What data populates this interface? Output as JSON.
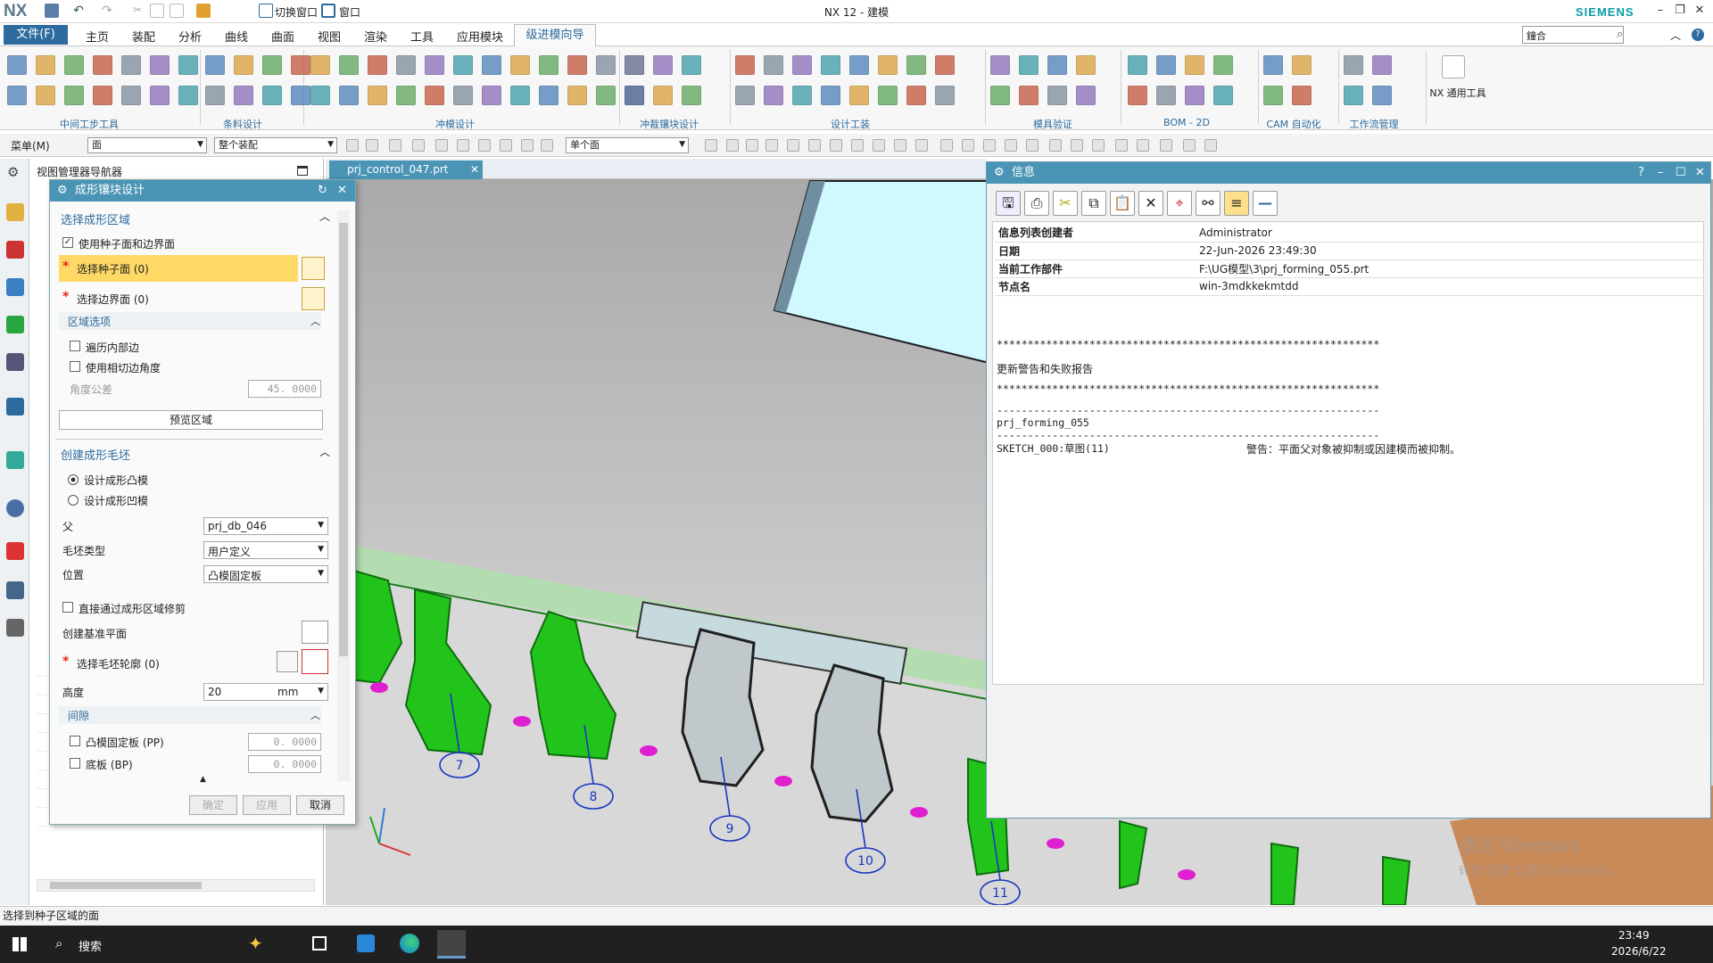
{
  "app": {
    "logo": "NX",
    "window_title": "NX 12 - 建模",
    "brand": "SIEMENS"
  },
  "quickbar": {
    "switch_window": "切换窗口",
    "window": "窗口"
  },
  "menubar": {
    "file": "文件(F)",
    "items": [
      "主页",
      "装配",
      "分析",
      "曲线",
      "曲面",
      "视图",
      "渲染",
      "工具",
      "应用模块"
    ],
    "active": "级进模向导",
    "search_value": "鐘合"
  },
  "ribbon": {
    "groups": [
      "中间工步工具",
      "条料设计",
      "冲模设计",
      "冲裁镶块设计",
      "设计工装",
      "模具验证",
      "BOM - 2D",
      "CAM 自动化",
      "工作流管理",
      "NX 通用工具"
    ]
  },
  "selbar": {
    "menu": "菜单(M)",
    "filter": "面",
    "scope": "整个装配",
    "mode": "单个面"
  },
  "navigator": {
    "title": "视图管理器导航器"
  },
  "dialog": {
    "title": "成形镶块设计",
    "sect1": "选择成形区域",
    "use_seed": "使用种子面和边界面",
    "select_seed": "选择种子面 (0)",
    "select_boundary": "选择边界面 (0)",
    "region_options": "区域选项",
    "traverse_inner": "遍历内部边",
    "use_tangent": "使用相切边角度",
    "angle_tol_label": "角度公差",
    "angle_tol_value": "45. 0000",
    "preview": "预览区域",
    "sect2": "创建成形毛坯",
    "design_punch": "设计成形凸模",
    "design_die": "设计成形凹模",
    "parent_label": "父",
    "parent_value": "prj_db_046",
    "blank_type_label": "毛坯类型",
    "blank_type_value": "用户定义",
    "position_label": "位置",
    "position_value": "凸模固定板",
    "direct_trim": "直接通过成形区域修剪",
    "datum_plane": "创建基准平面",
    "select_outline": "选择毛坯轮廓 (0)",
    "height_label": "高度",
    "height_value": "20",
    "height_unit": "mm",
    "clearance": "间隙",
    "pp_label": "凸模固定板 (PP)",
    "pp_value": "0. 0000",
    "bp_label": "底板 (BP)",
    "bp_value": "0. 0000",
    "ok": "确定",
    "apply": "应用",
    "cancel": "取消"
  },
  "viewport": {
    "tab": "prj_control_047.prt",
    "labels": [
      "7",
      "8",
      "9",
      "10",
      "11"
    ],
    "watermark1": "激活 Windows",
    "watermark2": "转到\"设置\"以激活 Windows。"
  },
  "info": {
    "title": "信息",
    "rows": [
      {
        "k": "信息列表创建者",
        "v": "Administrator"
      },
      {
        "k": "日期",
        "v": "22-Jun-2026 23:49:30"
      },
      {
        "k": "当前工作部件",
        "v": "F:\\UG模型\\3\\prj_forming_055.prt"
      },
      {
        "k": "节点名",
        "v": "win-3mdkkekmtdd"
      }
    ],
    "stars": "**************************************************************",
    "report_title": "更新警告和失败报告",
    "dashes": "--------------------------------------------------------------",
    "part": "prj_forming_055",
    "sketch": "SKETCH_000:草图(11)",
    "warning": "警告：平面父对象被抑制或因建模而被抑制。"
  },
  "status": {
    "text": "选择到种子区域的面"
  },
  "taskbar": {
    "search": "搜索",
    "time": "23:49",
    "date": "2026/6/22"
  },
  "colors": {
    "accent": "#4a94b6",
    "part_green": "#22c41c",
    "highlight": "#ffd966"
  }
}
